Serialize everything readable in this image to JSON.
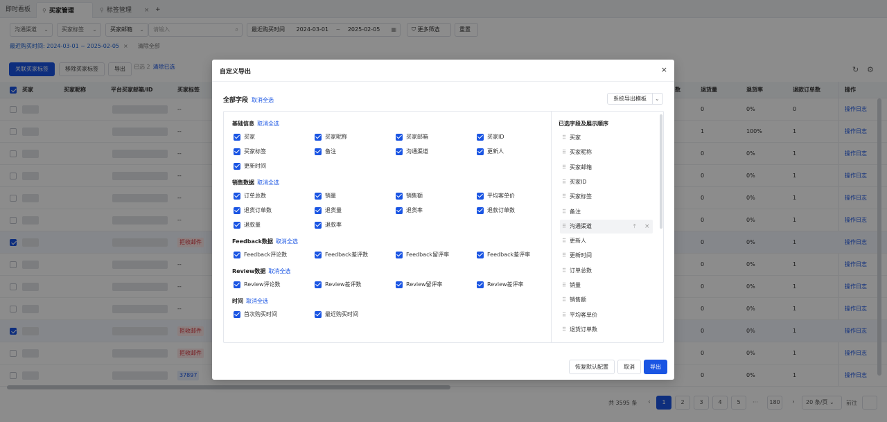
{
  "tabs": [
    {
      "label": "即时看板",
      "active": false
    },
    {
      "label": "买家管理",
      "active": true
    },
    {
      "label": "标签管理",
      "active": false
    }
  ],
  "tab_add": "+",
  "tab_close": "×",
  "filters": {
    "channel": "沟通渠道",
    "tag": "买家标签",
    "email_field": "买家邮箱",
    "search_placeholder": "请输入",
    "date_field": "最近购买时间",
    "date_start": "2024-03-01",
    "date_sep": "~",
    "date_end": "2025-02-05",
    "more": "更多筛选",
    "reset": "重置"
  },
  "active_filter": {
    "text": "最近购买时间: 2024-03-01 ~ 2025-02-05",
    "remove": "×",
    "clear_all": "清除全部"
  },
  "actions": {
    "link_tag": "关联买家标签",
    "remove_tag": "移除买家标签",
    "export": "导出",
    "selected": "已选 2",
    "clear_selected": "清除已选"
  },
  "table": {
    "columns_left": [
      "买家",
      "买家昵称",
      "平台买家邮箱/ID",
      "买家标签"
    ],
    "columns_right": [
      "数",
      "退货量",
      "退货率",
      "退款订单数",
      "操作"
    ],
    "rows": [
      {
        "checked": false,
        "tag": "--",
        "tag_style": "",
        "c1": "0",
        "c2": "0%",
        "c3": "0",
        "op": "操作日志"
      },
      {
        "checked": false,
        "tag": "--",
        "tag_style": "",
        "c1": "1",
        "c2": "100%",
        "c3": "1",
        "op": "操作日志"
      },
      {
        "checked": false,
        "tag": "--",
        "tag_style": "",
        "c1": "0",
        "c2": "0%",
        "c3": "1",
        "op": "操作日志"
      },
      {
        "checked": false,
        "tag": "--",
        "tag_style": "",
        "c1": "0",
        "c2": "0%",
        "c3": "1",
        "op": "操作日志"
      },
      {
        "checked": false,
        "tag": "--",
        "tag_style": "",
        "c1": "0",
        "c2": "0%",
        "c3": "1",
        "op": "操作日志"
      },
      {
        "checked": false,
        "tag": "--",
        "tag_style": "",
        "c1": "0",
        "c2": "0%",
        "c3": "1",
        "op": "操作日志"
      },
      {
        "checked": true,
        "tag": "拒收邮件",
        "tag_style": "red",
        "c1": "0",
        "c2": "0%",
        "c3": "1",
        "op": "操作日志"
      },
      {
        "checked": false,
        "tag": "--",
        "tag_style": "",
        "c1": "0",
        "c2": "0%",
        "c3": "1",
        "op": "操作日志"
      },
      {
        "checked": false,
        "tag": "--",
        "tag_style": "",
        "c1": "0",
        "c2": "0%",
        "c3": "1",
        "op": "操作日志"
      },
      {
        "checked": false,
        "tag": "--",
        "tag_style": "",
        "c1": "0",
        "c2": "0%",
        "c3": "1",
        "op": "操作日志"
      },
      {
        "checked": true,
        "tag": "拒收邮件",
        "tag_style": "red",
        "c1": "0",
        "c2": "0%",
        "c3": "1",
        "op": "操作日志"
      },
      {
        "checked": false,
        "tag": "拒收邮件",
        "tag_style": "red",
        "c1": "0",
        "c2": "0%",
        "c3": "1",
        "op": "操作日志"
      },
      {
        "checked": false,
        "tag": "37897",
        "tag_style": "blue",
        "c1": "0",
        "c2": "0%",
        "c3": "1",
        "op": "操作日志"
      }
    ]
  },
  "pagination": {
    "total": "共 3595 条",
    "prev": "‹",
    "pages": [
      "1",
      "2",
      "3",
      "4",
      "5"
    ],
    "ellipsis": "···",
    "last": "180",
    "next": "›",
    "size": "20 条/页",
    "goto": "前往"
  },
  "modal": {
    "title": "自定义导出",
    "close": "×",
    "all_fields": "全部字段",
    "cancel_all": "取消全选",
    "template": "系统导出模板",
    "groups": [
      {
        "title": "基础信息",
        "toggle": "取消全选",
        "items": [
          "买家",
          "买家昵称",
          "买家邮箱",
          "买家ID",
          "买家标签",
          "备注",
          "沟通渠道",
          "更新人",
          "更新时间"
        ]
      },
      {
        "title": "销售数据",
        "toggle": "取消全选",
        "items": [
          "订单总数",
          "销量",
          "销售额",
          "平均客单价",
          "退货订单数",
          "退货量",
          "退货率",
          "退款订单数",
          "退款量",
          "退款率"
        ]
      },
      {
        "title": "Feedback数据",
        "toggle": "取消全选",
        "items": [
          "Feedback评论数",
          "Feedback差评数",
          "Feedback留评率",
          "Feedback差评率"
        ]
      },
      {
        "title": "Review数据",
        "toggle": "取消全选",
        "items": [
          "Review评论数",
          "Review差评数",
          "Review留评率",
          "Review差评率"
        ]
      },
      {
        "title": "时间",
        "toggle": "取消全选",
        "items": [
          "首次购买时间",
          "最近购买时间"
        ]
      }
    ],
    "selected_title": "已选字段及展示顺序",
    "selected": [
      "买家",
      "买家昵称",
      "买家邮箱",
      "买家ID",
      "买家标签",
      "备注",
      "沟通渠道",
      "更新人",
      "更新时间",
      "订单总数",
      "销量",
      "销售额",
      "平均客单价",
      "退货订单数"
    ],
    "highlighted_index": 6,
    "restore": "恢复默认配置",
    "cancel": "取消",
    "export": "导出"
  },
  "colors": {
    "primary": "#1a55e3",
    "overlay": "rgba(0,0,0,0.45)"
  }
}
